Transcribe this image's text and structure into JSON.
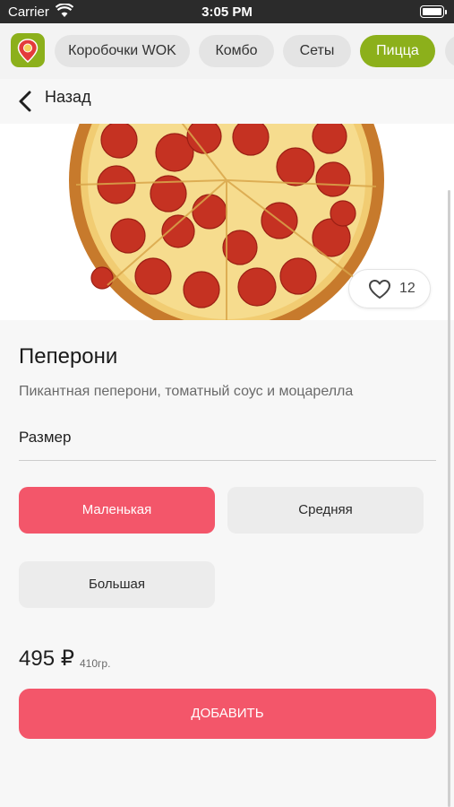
{
  "status_bar": {
    "carrier": "Carrier",
    "time": "3:05 PM"
  },
  "categories": {
    "items": [
      {
        "label": "Коробочки WOK",
        "active": false
      },
      {
        "label": "Комбо",
        "active": false
      },
      {
        "label": "Сеты",
        "active": false
      },
      {
        "label": "Пицца",
        "active": true
      }
    ]
  },
  "nav": {
    "back_label": "Назад"
  },
  "product": {
    "like_count": "12",
    "title": "Пеперони",
    "description": "Пикантная пеперони, томатный соус и моцарелла",
    "size_label": "Размер",
    "sizes": [
      {
        "label": "Маленькая",
        "selected": true
      },
      {
        "label": "Средняя",
        "selected": false
      },
      {
        "label": "Большая",
        "selected": false
      }
    ],
    "price": "495 ₽",
    "weight": "410гр.",
    "add_button": "ДОБАВИТЬ"
  },
  "colors": {
    "brand_green": "#8cb01b",
    "accent_red": "#f3566a",
    "pill_gray": "#e4e4e4"
  },
  "icons": [
    "wifi-icon",
    "battery-icon",
    "app-logo-icon",
    "back-chevron-icon",
    "heart-icon",
    "pizza-image"
  ]
}
